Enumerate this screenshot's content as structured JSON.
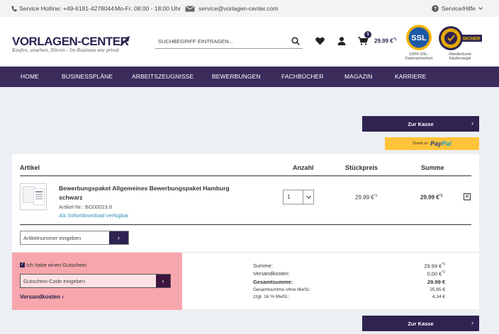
{
  "topbar": {
    "hotline": "Service Hotline: +49-6181-4278044",
    "hours": "Mo-Fr. 08:00 - 18:00 Uhr",
    "email": "service@vorlagen-center.com",
    "help": "Service/Hilfe"
  },
  "header": {
    "logo_text": "VORLAGEN-CENTER",
    "logo_slogan": "Kaufen, ansehen, führen – Im Business wie privat",
    "search_placeholder": "SUCHBEGRIFF EINTRAGEN...",
    "cart_count": "1",
    "cart_total": "29.99 €",
    "cart_total_sup": "*1",
    "ssl_badge": "SSL",
    "ssl_caption_1": "100% SSL-",
    "ssl_caption_2": "Datensicherheit",
    "seal_text": "SICHER",
    "seal_caption_1": "Händlerbund",
    "seal_caption_2": "Käufersiegel"
  },
  "nav": {
    "items": [
      "HOME",
      "BUSINESSPLÄNE",
      "ARBEITSZEUGNISSE",
      "BEWERBUNGEN",
      "FACHBÜCHER",
      "MAGAZIN",
      "KARRIERE"
    ]
  },
  "actions": {
    "checkout_label": "Zur Kasse",
    "paypal_prefix": "Direkt zu",
    "paypal_pay": "Pay",
    "paypal_pal": "Pal"
  },
  "cart": {
    "columns": [
      "Artikel",
      "Anzahl",
      "Stückpreis",
      "Summe"
    ],
    "item": {
      "name": "Bewerbungspaket Allgemeines Bewerbungspaket Hamburg schwarz",
      "article_no": "Artikel-Nr.: BG00023.8",
      "availability": "Als Sofortdownload verfügbar",
      "quantity": "1",
      "unit_price": "29.99 €",
      "unit_price_sup": "*1",
      "total": "29.99 €",
      "total_sup": "*1",
      "remove": "✕"
    },
    "article_input_placeholder": "Artikelnummer eingeben"
  },
  "voucher": {
    "checkbox_label": "Ich habe einen Gutschein",
    "checked": true,
    "input_placeholder": "Gutschein-Code eingeben",
    "shipping_link": "Versandkosten"
  },
  "summary": {
    "rows": [
      {
        "label": "Summe:",
        "value": "29.99 €",
        "sup": "*1"
      },
      {
        "label": "Versandkosten:",
        "value": "0,00 €",
        "sup": "*2"
      },
      {
        "label": "Gesamtsumme:",
        "value": "29.99 €",
        "sup": ""
      },
      {
        "label": "Gesamtsumme ohne MwSt.:",
        "value": "25,85 €",
        "sup": ""
      },
      {
        "label": "zzgl. 16 % MwSt.:",
        "value": "4,14 €",
        "sup": ""
      }
    ]
  },
  "colors": {
    "brand": "#2f2352",
    "nav": "#3b2c5c",
    "paypal": "#ffc43a",
    "voucher_highlight": "#f7a6ad",
    "link": "#2a8fb8"
  }
}
